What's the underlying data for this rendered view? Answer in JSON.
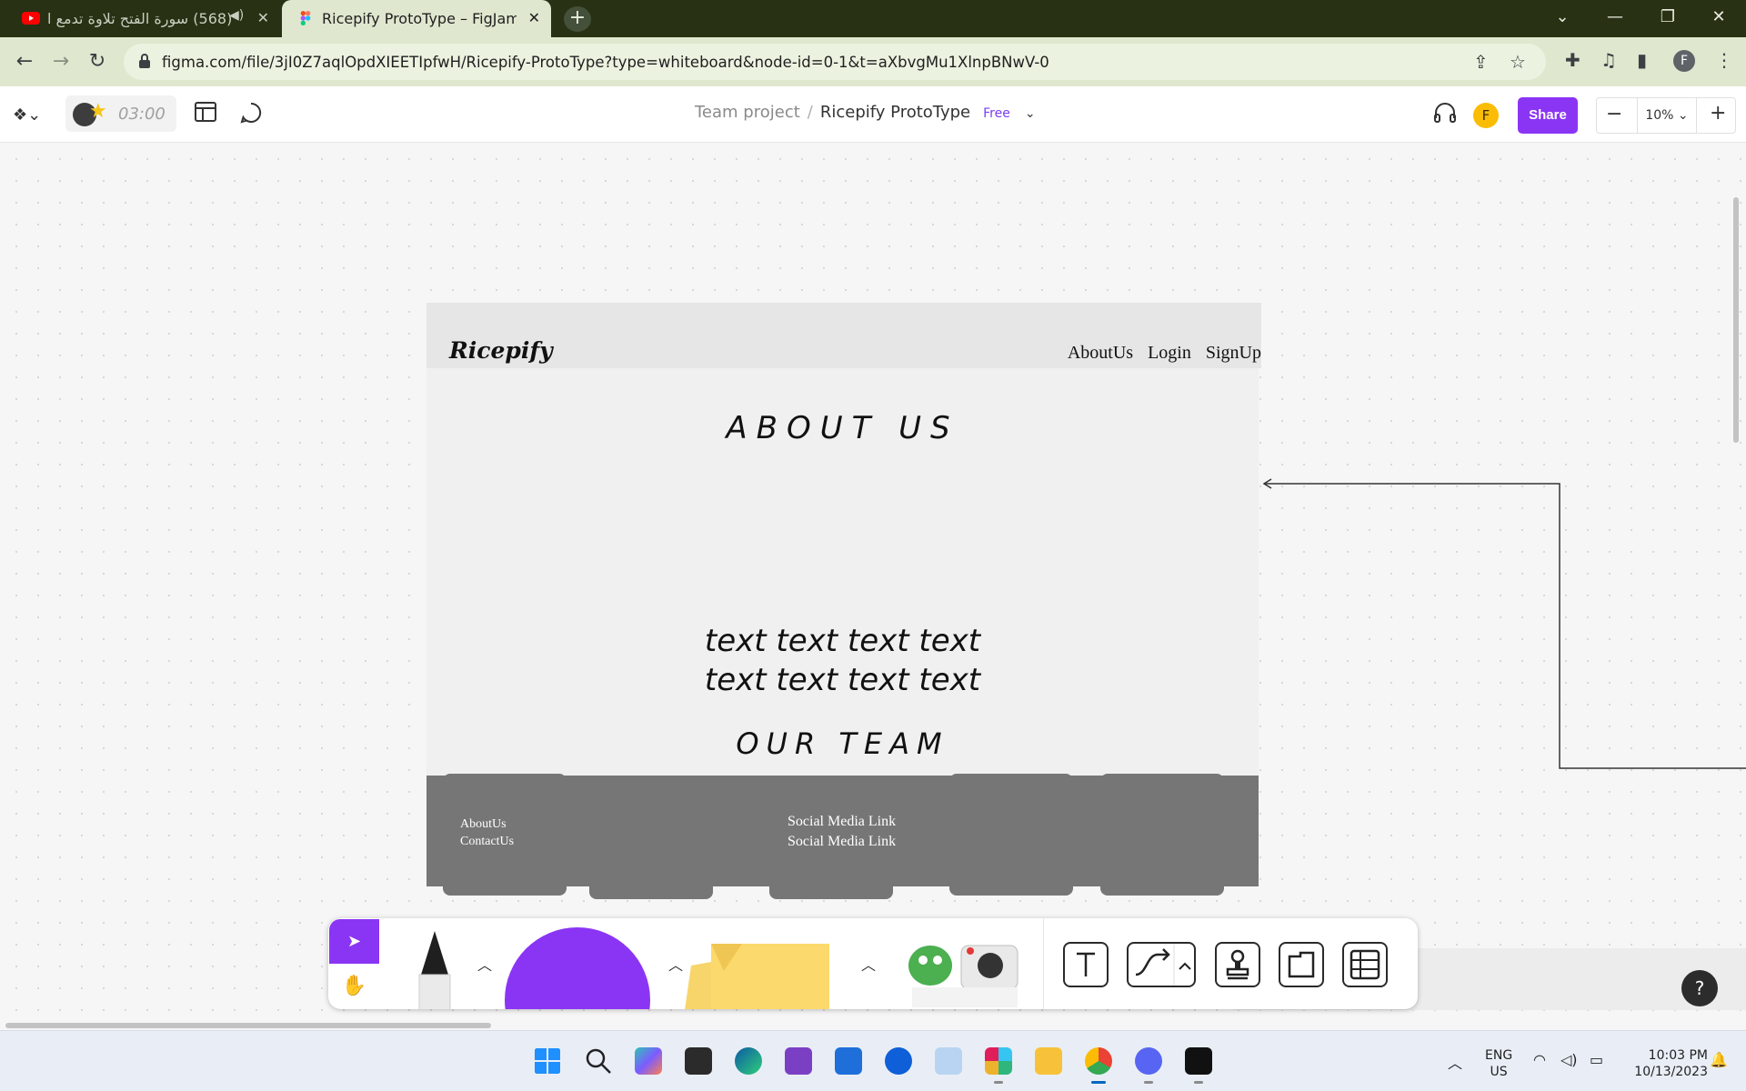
{
  "browser": {
    "tabs": [
      {
        "title": "(568) سورة الفتح تلاوة تدمع ا",
        "active": false
      },
      {
        "title": "Ricepify ProtoType – FigJam",
        "active": true
      }
    ],
    "url": "figma.com/file/3jI0Z7aqlOpdXIEETIpfwH/Ricepify-ProtoType?type=whiteboard&node-id=0-1&t=aXbvgMu1XlnpBNwV-0",
    "profile_initial": "F"
  },
  "figjam": {
    "timer": "03:00",
    "breadcrumb": {
      "team": "Team project",
      "file": "Ricepify ProtoType",
      "badge": "Free"
    },
    "user_initial": "F",
    "share_label": "Share",
    "zoom": "10%"
  },
  "frame": {
    "brand": "Ricepify",
    "nav": [
      "AboutUs",
      "Login",
      "SignUp"
    ],
    "heading": "ABOUT US",
    "text_line1": "text text text text",
    "text_line2": "text text text text",
    "team_heading": "OUR TEAM",
    "footer_left": [
      "AboutUs",
      "ContactUs"
    ],
    "footer_right": [
      "Social Media Link",
      "Social Media Link"
    ]
  },
  "taskbar": {
    "lang": "ENG",
    "region": "US",
    "time": "10:03 PM",
    "date": "10/13/2023"
  },
  "colors": {
    "accent": "#8b35f4",
    "tab_strip": "#283113",
    "toolbar": "#dfe7cf",
    "wire_dark": "#767676"
  },
  "icons": [
    "youtube-icon",
    "speaker-icon",
    "figma-icon",
    "lock-icon",
    "share-page-icon",
    "star-icon",
    "extensions-icon",
    "media-icon",
    "sidebar-icon",
    "more-icon",
    "headphones-icon",
    "layout-icon",
    "comment-icon",
    "hand-icon",
    "select-icon",
    "pen-icon",
    "text-icon",
    "connector-icon",
    "stamp-icon",
    "section-icon",
    "table-icon",
    "help-icon"
  ]
}
